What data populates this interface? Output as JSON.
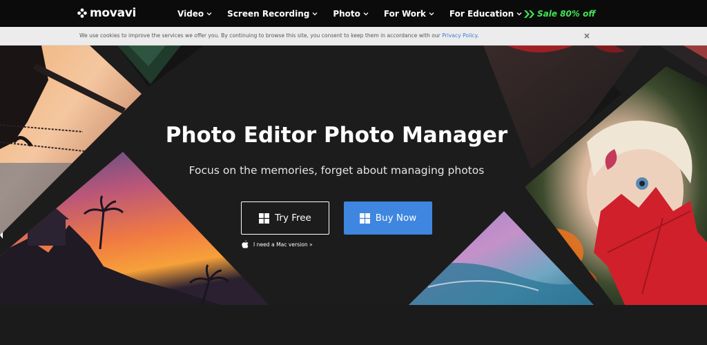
{
  "nav": {
    "logo_text": "movavi",
    "items": [
      {
        "label": "Video"
      },
      {
        "label": "Screen Recording"
      },
      {
        "label": "Photo"
      },
      {
        "label": "For Work"
      },
      {
        "label": "For Education"
      }
    ],
    "sale_label": "Sale 80% off",
    "sale_color": "#3ee655"
  },
  "cookie": {
    "text": "We use cookies to improve the services we offer you. By continuing to browse this site, you consent to keep them in accordance with our ",
    "link_label": "Privacy Policy",
    "trailing": "."
  },
  "hero": {
    "title": "Photo Editor Photo Manager",
    "subtitle": "Focus on the memories, forget about managing photos",
    "try_label": "Try Free",
    "buy_label": "Buy Now",
    "mac_label": "I need a Mac version »",
    "buy_color": "#3e86e0"
  },
  "icons": {
    "logo": "movavi-logo-icon",
    "chevron": "chevron-down-icon",
    "sale": "double-arrow-icon",
    "close": "close-icon",
    "windows": "windows-icon",
    "apple": "apple-icon"
  }
}
